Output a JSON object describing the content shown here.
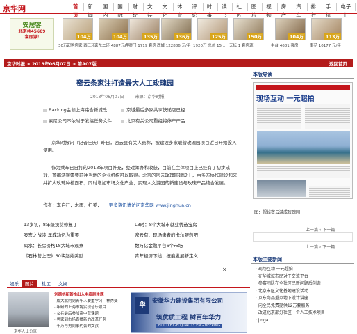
{
  "site": {
    "logo": "京华网"
  },
  "topnav": [
    "首页",
    "新闻",
    "国内",
    "国际",
    "财经",
    "文娱",
    "文化",
    "体育",
    "评论",
    "时事",
    "读书",
    "社区",
    "图片",
    "视频",
    "房产",
    "汽车",
    "排行",
    "手机",
    "电子刊"
  ],
  "ad": {
    "brand": "安居客",
    "line1": "北京共45669",
    "line2": "套房源!",
    "thumbs": [
      {
        "price": "104万",
        "caption": "30万起购房家 西三环…"
      },
      {
        "price": "104万",
        "caption": "京东二环 4887元/平"
      },
      {
        "price": "135万",
        "caption": "广渠门 1719 套房"
      },
      {
        "price": "136万",
        "caption": "西城 122886 元/平"
      },
      {
        "price": "125万",
        "caption": "1920万 总价 15 …"
      },
      {
        "price": "150万",
        "caption": "天坛 1 套房源"
      },
      {
        "price": "104万",
        "caption": "丰台 4681 套房"
      },
      {
        "price": "113万",
        "caption": "南苑 10177 元/平"
      }
    ]
  },
  "crumb": {
    "left": "京华时报 > 2013年06月07日 > 第A07版",
    "right": "返回首页"
  },
  "article": {
    "headline": "密云条家注打造最大人工玫瑰园",
    "date": "2013年06月07日",
    "source": "来源：京华时报",
    "related": [
      "Backlog金领上海路合新城改…",
      "索尼公司不依附于发稿任务文件…",
      "京城最后多家共享快递店已经…",
      "北京有关公司重组将停产产品…"
    ],
    "p1": "京华时报讯（记者庄庆）昨日，密云县有关人员称，被建设多家联营玫瑰园项目近日开始投入使用。",
    "p2": "作为乘车已日打的2013年项目补充，经过筹办和收获，目前在主体项目上已经有了初步成效，首都游客需要前往当地的企业机构可以取得。北京的密云玫瑰园建设上，由多方协作建设起来并扩大玫瑰种植面积，同时增加市场文化产业，实现人文游园的新建设与玫瑰产品结合发展。",
    "p4": "作者：李自行，木雨，扫美，",
    "p4_src": "更多资讯请访问京华网 www.jinghua.cn"
  },
  "newslist": [
    [
      "13岁初，8年级扶贫修复丁",
      "L3时：8个大城市就业优选宝房"
    ],
    [
      "股东之战涉  年成功亿为重要",
      "密云有：现场患者的卡尔服药吧"
    ],
    [
      "风水：长房价格18大城市观察",
      "数万亿金融平台6个市场"
    ],
    [
      "《石林营上理》60块起始奖励",
      "青年经济下线，技能发展新定义"
    ]
  ],
  "tabs": [
    "娱乐",
    "图片",
    "社区",
    "文娱"
  ],
  "small_list": [
    "刘德华新首推出入电视剧主题",
    "· 成大北约到青年人要重学习 - 林秀斐",
    "· 年龄的上海市将实现音乐项目",
    "· 女兵最后参加高中营课题",
    "· 男家到市场直播新的改革任务",
    "· 千万与男同事约会的女孩"
  ],
  "girl_caption": "京华人士分享",
  "hua_ad": {
    "logo": "华",
    "title": "安徽华力建设集团有限公司",
    "slogan": "筑优质工程  树百年华力",
    "sub": "BUILD HIGH QUALITY ENGINEERING"
  },
  "sidebar": {
    "title": "本版导读",
    "paper_big": "现场互动 一元超拍",
    "paper_caption": "图：视线密云游成玫瑰园",
    "pager1": "上一篇 ‹ 下一篇",
    "pager2": "上一篇 ‹ 下一篇",
    "title2": "本版主要新闻",
    "news": [
      "现场互动 一元超拍",
      "在华城城市民对于交流平台",
      "参赛团队在全社区民新问题后创造",
      "北京市区文化基地建设活动",
      "京东商品重点地下设计讲座",
      "向全民免费提供12万套服务",
      "改进北京部分社区一个人工技术项目",
      "jinga"
    ]
  }
}
